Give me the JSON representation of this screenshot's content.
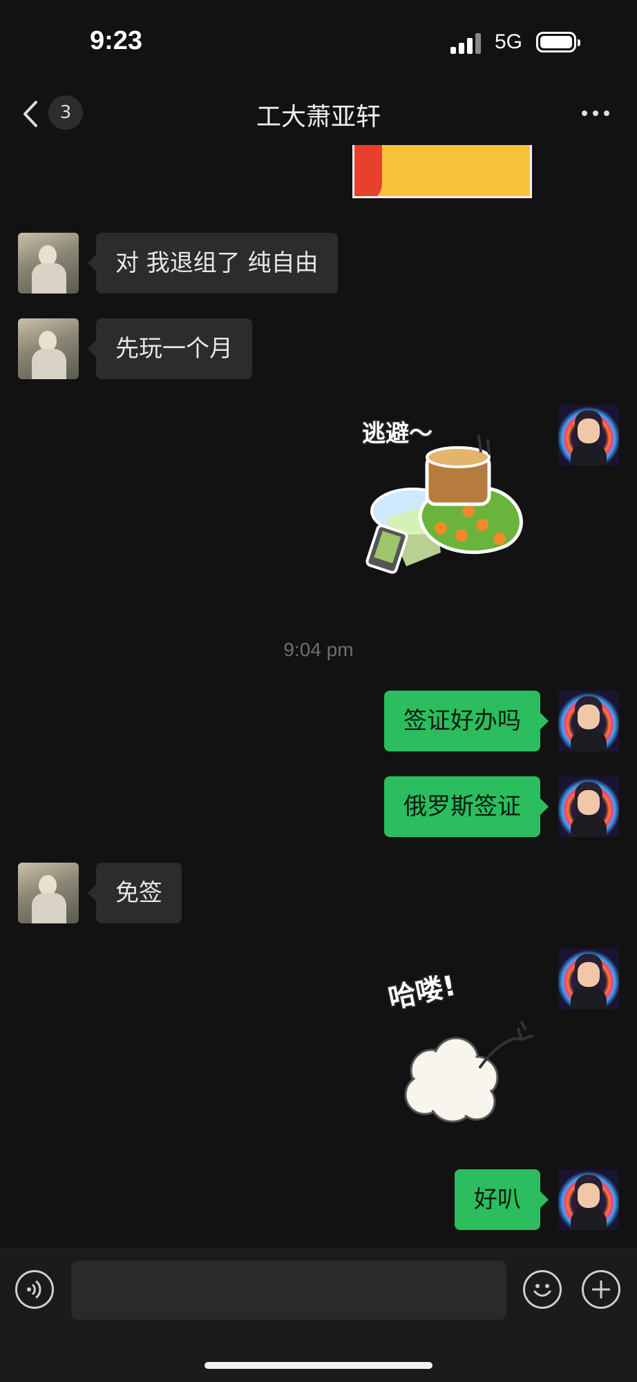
{
  "status": {
    "time": "9:23",
    "network": "5G"
  },
  "nav": {
    "unread_count": "3",
    "title": "工大萧亚轩"
  },
  "messages": {
    "m1": "对 我退组了 纯自由",
    "m2": "先玩一个月",
    "sticker1_text": "逃避～",
    "timestamp": "9:04 pm",
    "m3": "签证好办吗",
    "m4": "俄罗斯签证",
    "m5": "免签",
    "sticker2_text": "哈喽!",
    "m6": "好叭"
  },
  "input": {
    "placeholder": "",
    "value": ""
  },
  "colors": {
    "background": "#121212",
    "my_bubble": "#2bbd5e",
    "their_bubble": "#2c2c2c",
    "timestamp": "#6e6e6e"
  },
  "icons": {
    "back": "chevron-left-icon",
    "more": "more-dots-icon",
    "voice": "voice-icon",
    "emoji": "emoji-icon",
    "plus": "plus-icon"
  }
}
